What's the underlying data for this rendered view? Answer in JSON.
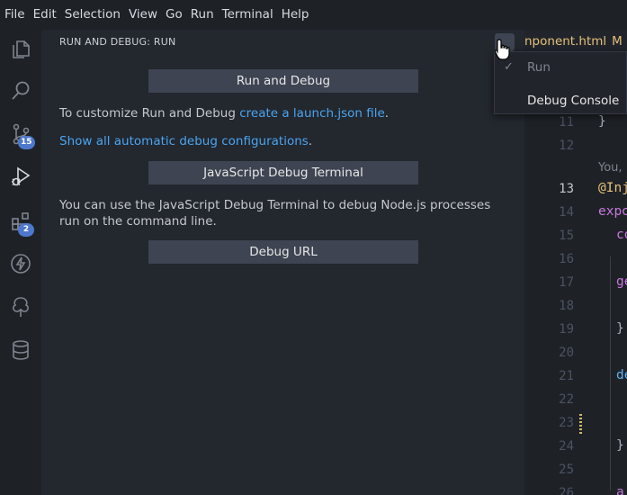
{
  "menubar": {
    "items": [
      "File",
      "Edit",
      "Selection",
      "View",
      "Go",
      "Run",
      "Terminal",
      "Help"
    ]
  },
  "activity_bar": {
    "source_control_badge": "15",
    "extensions_badge": "2"
  },
  "sidebar": {
    "title": "RUN AND DEBUG: RUN",
    "run_and_debug_button": "Run and Debug",
    "customize_text": "To customize Run and Debug ",
    "create_launch_link": "create a launch.json file",
    "customize_end": ".",
    "show_configs_link": "Show all automatic debug configurations",
    "show_configs_end": ".",
    "js_terminal_button": "JavaScript Debug Terminal",
    "js_terminal_text": "You can use the JavaScript Debug Terminal to debug Node.js processes run on the command line.",
    "debug_url_button": "Debug URL"
  },
  "tab": {
    "label": "nponent.html",
    "modified": "M"
  },
  "dropdown": {
    "items": [
      {
        "label": "Run",
        "checked": true
      },
      {
        "label": "Debug Console",
        "checked": false
      }
    ]
  },
  "editor": {
    "line_numbers": [
      "11",
      "12",
      "13",
      "14",
      "15",
      "16",
      "17",
      "18",
      "19",
      "20",
      "21",
      "22",
      "23",
      "24",
      "25",
      "26"
    ],
    "active_line": "13",
    "blame": "You,",
    "code_fragments": {
      "l11": "}",
      "l13": "@Inj",
      "l14": "expo",
      "l15": "co",
      "l17": "ge",
      "l19": "}",
      "l21": "de",
      "l24": "}",
      "l26": "a"
    }
  },
  "colors": {
    "accent_badge": "#4d78cc",
    "link": "#4aa5f0",
    "button_bg": "#3e4452",
    "modified_tab": "#e5c07b"
  }
}
